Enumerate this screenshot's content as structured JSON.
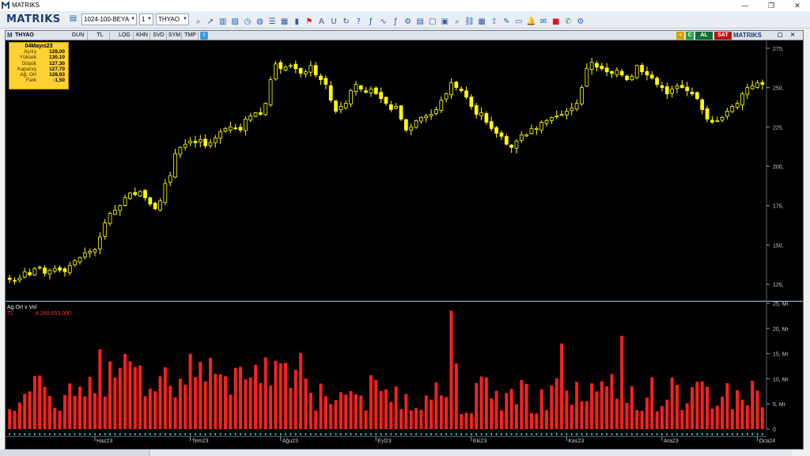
{
  "window": {
    "title": "MATRIKS",
    "minimize": "—",
    "maximize": "❐",
    "close": "✕"
  },
  "toolbar": {
    "brand": "MATRIKS",
    "layout_select": "1024-100-BEYA",
    "count_select": "1",
    "symbol_select": "THYAO",
    "icons": [
      "save-icon",
      "search-icon",
      "cursor-icon",
      "bar-chart-icon",
      "picture-icon",
      "clock-icon",
      "globe-icon",
      "list-icon",
      "table-icon",
      "book-icon",
      "alert-icon",
      "font-icon",
      "magnet-icon",
      "redo-icon",
      "help-icon",
      "fx-icon",
      "wave-icon",
      "fx2-icon",
      "settings-icon",
      "calendar-icon",
      "window-icon",
      "layout-icon",
      "zoom-icon",
      "link-icon",
      "grid-icon",
      "export-icon",
      "pencil-icon",
      "screen-icon",
      "bell-icon",
      "mail-icon",
      "stop-icon",
      "chat-icon",
      "gear-icon"
    ]
  },
  "chart_window": {
    "symbol": "THYAO",
    "period_buttons": [
      "GUN",
      "TL",
      "LOG",
      "KHN",
      "SVD",
      "SYM",
      "TMP"
    ],
    "buy_label": "AL",
    "sell_label": "SAT",
    "brand": "MATRIKS",
    "info": {
      "date": "04Mayıs23",
      "rows": [
        {
          "k": "Açılış",
          "v": "128,00"
        },
        {
          "k": "Yüksek",
          "v": "130,10"
        },
        {
          "k": "Düşük",
          "v": "127,30"
        },
        {
          "k": "Kapanış",
          "v": "127,70"
        },
        {
          "k": "Ağ. Ort",
          "v": "128,93"
        },
        {
          "k": "Fark",
          "v": "-1,50"
        }
      ]
    },
    "volume_title": "Ag.Ort x Vol",
    "volume_unit": "TL",
    "volume_value": ":4.269.653.000"
  },
  "chart_data": {
    "type": "candlestick+bar",
    "price_axis_ticks": [
      275,
      250,
      225,
      200,
      175,
      150,
      125
    ],
    "price_axis_labels": [
      "275,",
      "250,",
      "225,",
      "200,",
      "175,",
      "150,",
      "125,"
    ],
    "price_ylim": [
      115,
      280
    ],
    "volume_axis_ticks": [
      25,
      20,
      15,
      10,
      5,
      0
    ],
    "volume_axis_labels": [
      "25, Mr",
      "20, Mr",
      "15, Mr",
      "10, Mr",
      "5, Mr",
      "0"
    ],
    "volume_ylim": [
      0,
      25
    ],
    "x_labels": [
      "Haz23",
      "Tem23",
      "Ağu23",
      "Eyl23",
      "Eki23",
      "Kas23",
      "Ara23",
      "Oca24"
    ],
    "x_label_index": [
      17,
      36,
      54,
      73,
      92,
      111,
      130,
      149
    ],
    "candle_color": "#ffff00",
    "volume_color": "#ff2020",
    "close": [
      128,
      127,
      129,
      133,
      131,
      135,
      136,
      132,
      134,
      135,
      134,
      133,
      137,
      140,
      142,
      145,
      146,
      147,
      155,
      164,
      170,
      172,
      175,
      180,
      183,
      182,
      184,
      180,
      176,
      173,
      178,
      189,
      194,
      208,
      212,
      214,
      216,
      215,
      217,
      213,
      215,
      218,
      222,
      224,
      225,
      224,
      223,
      230,
      232,
      234,
      233,
      240,
      255,
      265,
      262,
      263,
      264,
      262,
      259,
      260,
      264,
      258,
      255,
      252,
      242,
      235,
      238,
      240,
      248,
      252,
      249,
      247,
      249,
      246,
      243,
      240,
      236,
      238,
      230,
      223,
      225,
      229,
      231,
      232,
      233,
      236,
      242,
      246,
      253,
      250,
      248,
      244,
      238,
      233,
      234,
      228,
      224,
      221,
      219,
      214,
      212,
      216,
      220,
      220,
      224,
      224,
      228,
      229,
      231,
      232,
      233,
      235,
      237,
      240,
      250,
      262,
      266,
      263,
      262,
      260,
      259,
      261,
      258,
      255,
      257,
      264,
      260,
      258,
      256,
      252,
      250,
      246,
      249,
      251,
      250,
      248,
      246,
      243,
      236,
      230,
      228,
      229,
      231,
      235,
      238,
      240,
      246,
      250,
      251,
      253,
      252
    ]
  }
}
